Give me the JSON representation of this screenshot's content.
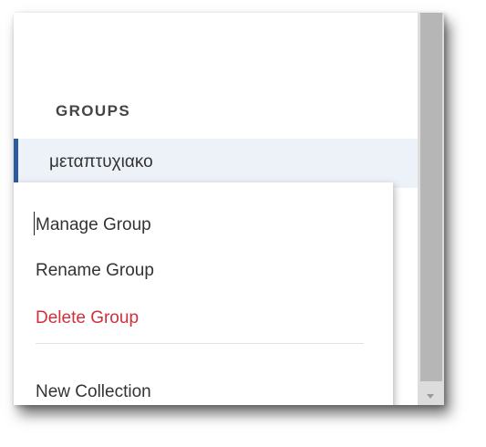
{
  "sidebar": {
    "section_heading": "GROUPS",
    "selected_group": "μεταπτυχιακο"
  },
  "context_menu": {
    "items": [
      {
        "label": "Manage Group"
      },
      {
        "label": "Rename Group"
      },
      {
        "label": "Delete Group"
      },
      {
        "label": "New Collection"
      }
    ]
  },
  "colors": {
    "selection_marker": "#2d5a9e",
    "selection_background": "#edf1f8",
    "danger": "#d0303c"
  }
}
